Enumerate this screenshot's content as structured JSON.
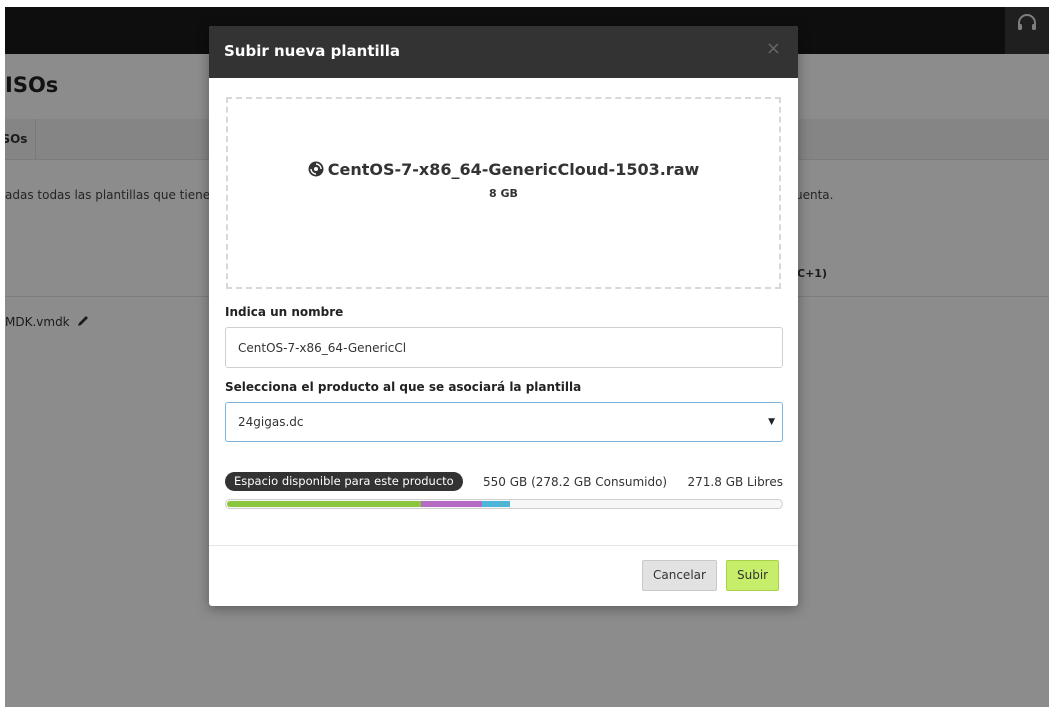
{
  "background": {
    "page_title": "ISOs",
    "tab_label": "ISOs",
    "description_left": "adas todas las plantillas que tiene",
    "description_right": "uenta.",
    "column_right": "C+1)",
    "column_left": "",
    "row_file": "MDK.vmdk"
  },
  "modal": {
    "title": "Subir nueva plantilla",
    "close_icon": "×",
    "file": {
      "name": "CentOS-7-x86_64-GenericCloud-1503.raw",
      "size": "8 GB",
      "icon": "disc-icon"
    },
    "name_label": "Indica un nombre",
    "name_value": "CentOS-7-x86_64-GenericCl",
    "product_label": "Selecciona el producto al que se asociará la plantilla",
    "product_selected": "24gigas.dc",
    "space": {
      "badge": "Espacio disponible para este producto",
      "info": "550 GB (278.2 GB Consumido)",
      "free": "271.8 GB Libres",
      "bar_segments": [
        {
          "name": "used-green",
          "percent": 35,
          "color": "#8cc63f"
        },
        {
          "name": "used-purple",
          "percent": 11,
          "color": "#b36bc4"
        },
        {
          "name": "used-blue",
          "percent": 5,
          "color": "#4bb6d8"
        }
      ]
    },
    "buttons": {
      "cancel": "Cancelar",
      "submit": "Subir"
    }
  },
  "colors": {
    "header_bg": "#333333",
    "submit_bg": "#c6ee6a",
    "select_border": "#7fb3dc"
  }
}
